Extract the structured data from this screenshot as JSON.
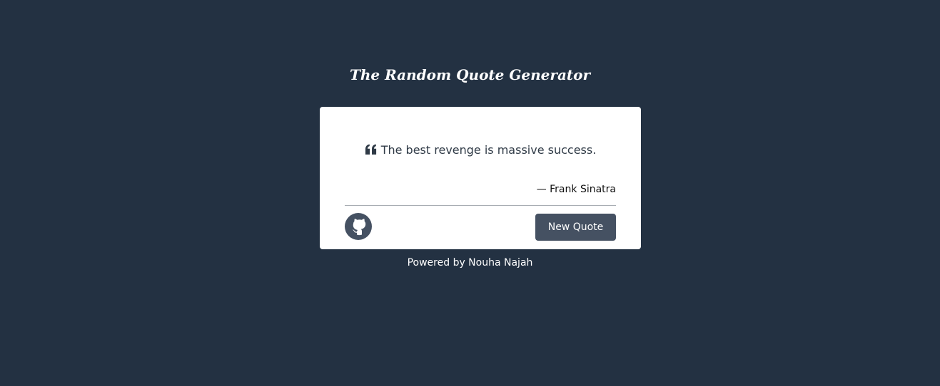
{
  "page": {
    "title": "The Random Quote Generator"
  },
  "quote": {
    "text": "The best revenge is massive success.",
    "author": "— Frank Sinatra"
  },
  "actions": {
    "new_quote_label": "New Quote",
    "github_icon": "github-icon"
  },
  "footer": {
    "text": "Powered by Nouha Najah"
  },
  "colors": {
    "background": "#233142",
    "card": "#ffffff",
    "button": "#455162",
    "text_dark": "#2f3a46"
  }
}
